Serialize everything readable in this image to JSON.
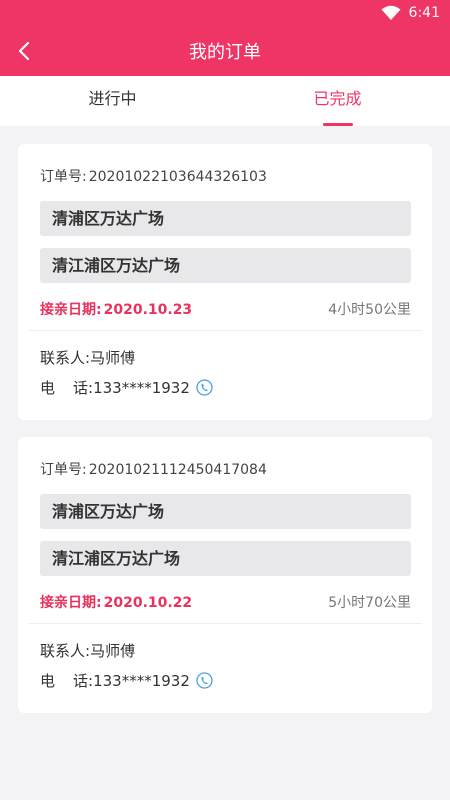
{
  "status_bar": {
    "time": "6:41",
    "wifi_icon": "wifi-icon"
  },
  "header": {
    "title": "我的订单",
    "back_icon": "chevron-left-icon",
    "color": "#ee3566"
  },
  "tabs": [
    {
      "label": "进行中",
      "active": false
    },
    {
      "label": "已完成",
      "active": true
    }
  ],
  "orders": [
    {
      "order_label": "订单号:",
      "order_no": "20201022103644326103",
      "from": "清浦区万达广场",
      "to": "清江浦区万达广场",
      "date_label": "接亲日期:",
      "date": "2020.10.23",
      "duration": "4小时50公里",
      "contact_label": "联系人:",
      "contact_name": "马师傅",
      "phone_label_1": "电",
      "phone_label_2": "话:",
      "phone": "133****1932"
    },
    {
      "order_label": "订单号:",
      "order_no": "20201021112450417084",
      "from": "清浦区万达广场",
      "to": "清江浦区万达广场",
      "date_label": "接亲日期:",
      "date": "2020.10.22",
      "duration": "5小时70公里",
      "contact_label": "联系人:",
      "contact_name": "马师傅",
      "phone_label_1": "电",
      "phone_label_2": "话:",
      "phone": "133****1932"
    }
  ],
  "colors": {
    "accent": "#ee3566",
    "date_text": "#e8335e",
    "phone_icon": "#4aa3e0"
  }
}
